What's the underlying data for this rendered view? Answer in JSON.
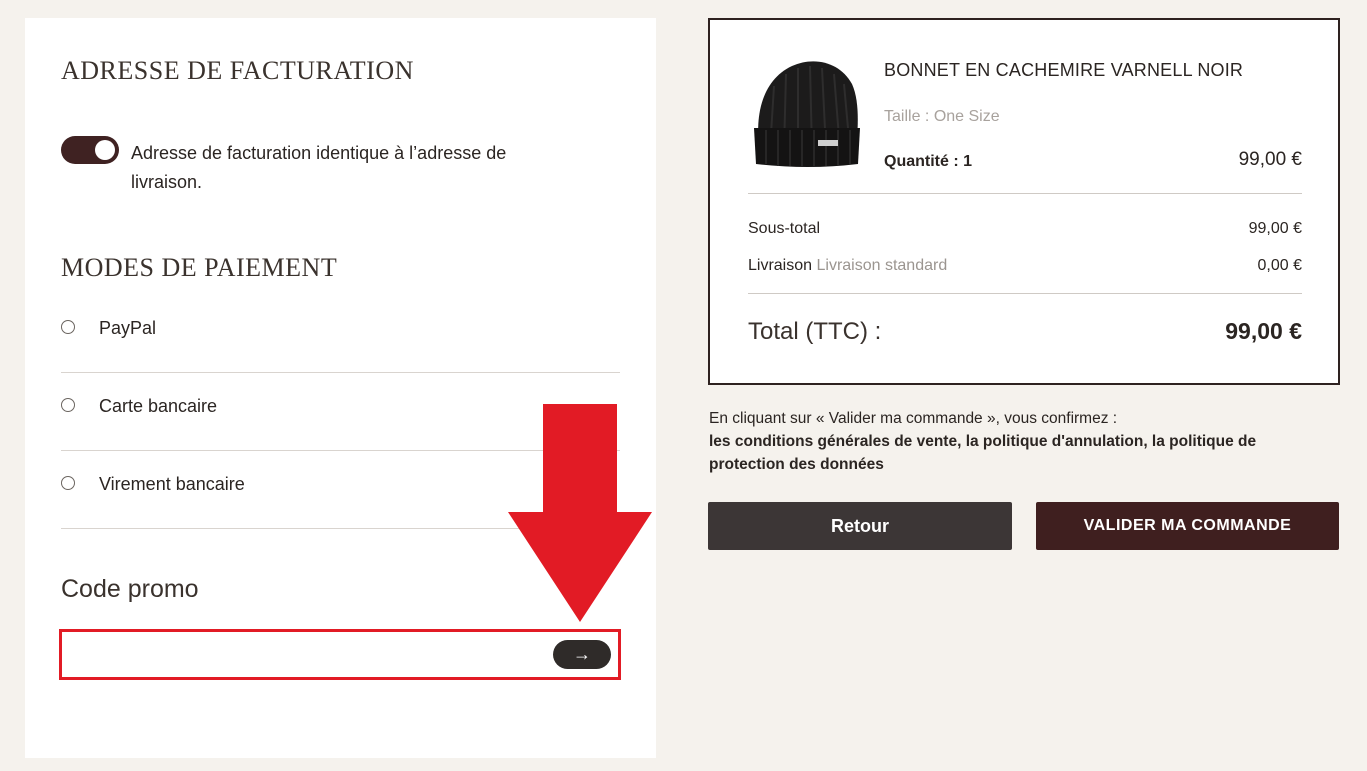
{
  "billing": {
    "title": "ADRESSE DE FACTURATION",
    "same_address_label": "Adresse de facturation identique à l’adresse de livraison.",
    "same_address_enabled": true
  },
  "payment": {
    "title": "MODES DE PAIEMENT",
    "methods": [
      {
        "label": "PayPal"
      },
      {
        "label": "Carte bancaire"
      },
      {
        "label": "Virement bancaire"
      }
    ]
  },
  "promo": {
    "title": "Code promo",
    "value": "",
    "submit_icon": "→"
  },
  "summary": {
    "product": {
      "name": "BONNET EN CACHEMIRE VARNELL NOIR",
      "size_label": "Taille :",
      "size_value": "One Size",
      "qty_label": "Quantité :",
      "qty_value": "1",
      "price": "99,00 €",
      "image_icon": "beanie-image"
    },
    "subtotal_label": "Sous-total",
    "subtotal_value": "99,00 €",
    "shipping_label": "Livraison",
    "shipping_method": "Livraison standard",
    "shipping_value": "0,00 €",
    "total_label": "Total (TTC) :",
    "total_value": "99,00 €"
  },
  "notice": {
    "line1": "En cliquant sur « Valider ma commande », vous confirmez :",
    "links": "les conditions générales de vente, la politique d'annulation, la politique de protection des données"
  },
  "actions": {
    "back_label": "Retour",
    "validate_label": "VALIDER MA COMMANDE"
  },
  "colors": {
    "accent": "#3f1f1f",
    "highlight": "#e21b25",
    "background": "#f5f2ed"
  }
}
